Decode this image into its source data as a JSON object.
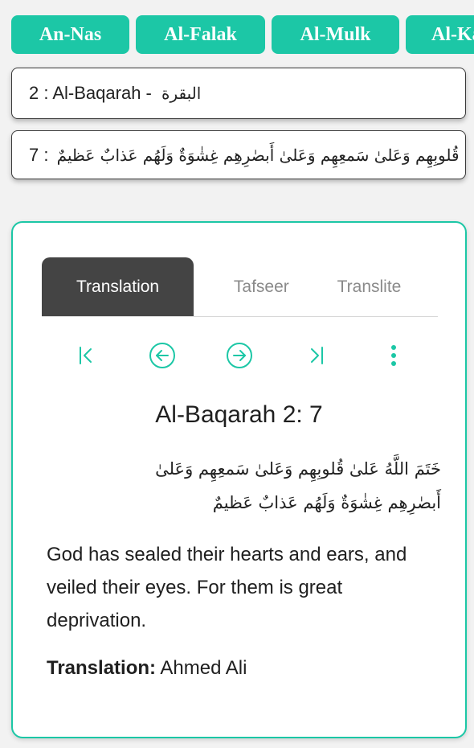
{
  "surah_chips": [
    "An-Nas",
    "Al-Falak",
    "Al-Mulk",
    "Al-Kahf"
  ],
  "surah_select": {
    "value": "2 : Al-Baqarah - ",
    "arabic": "البقرة"
  },
  "ayah_select": {
    "value": "7 : ",
    "arabic": "قُلوبِهِم وَعَلىٰ سَمعِهِم وَعَلىٰ أَبصٰرِهِم غِشٰوَةٌ وَلَهُم عَذابٌ عَظيمٌ"
  },
  "tabs": [
    "Translation",
    "Tafseer",
    "Translite"
  ],
  "active_tab": "Translation",
  "nav_icons": [
    "first-icon",
    "previous-icon",
    "next-icon",
    "last-icon",
    "more-icon"
  ],
  "verse": {
    "title": "Al-Baqarah 2: 7",
    "arabic": "خَتَمَ اللَّهُ عَلىٰ قُلوبِهِم وَعَلىٰ سَمعِهِم وَعَلىٰ أَبصٰرِهِم غِشٰوَةٌ وَلَهُم عَذابٌ عَظيمٌ",
    "translation": "God has sealed their hearts and ears, and veiled their eyes. For them is great deprivation.",
    "translator_label": "Translation:",
    "translator_name": " Ahmed Ali"
  },
  "colors": {
    "accent": "#1cc7a6",
    "active_tab": "#444444",
    "background": "#f2f2f2"
  }
}
